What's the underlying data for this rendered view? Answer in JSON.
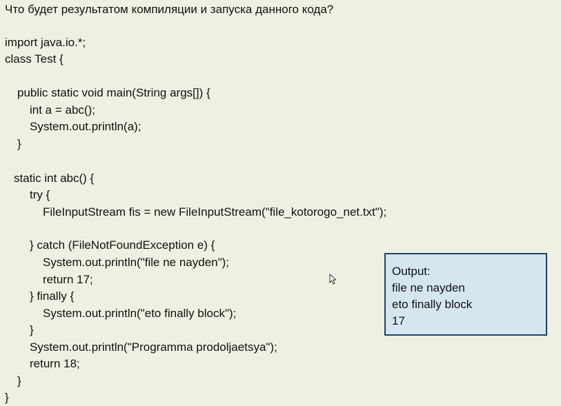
{
  "question": "Что будет результатом компиляции и запуска данного кода?",
  "code_lines": [
    "import java.io.*;",
    "class Test {",
    "public static void main(String args[]) {",
    "int a = abc();",
    "System.out.println(a);",
    "}",
    "static int abc() {",
    "try {",
    "FileInputStream fis = new FileInputStream(\"file_kotorogo_net.txt\");",
    "} catch (FileNotFoundException e) {",
    "System.out.println(\"file ne nayden\");",
    "return 17;",
    "} finally {",
    "System.out.println(\"eto finally block\");",
    "}",
    "System.out.println(\"Programma prodoljaetsya\");",
    "return 18;",
    "}",
    "}"
  ],
  "output_box": {
    "lines": [
      "Output:",
      "file ne nayden",
      "eto finally block",
      "17"
    ]
  },
  "colors": {
    "background": "#eef0e2",
    "output_fill": "#d6e6ef",
    "output_border": "#1f3f70",
    "text": "#111111"
  },
  "icons": {
    "cursor": "mouse-pointer-icon"
  }
}
